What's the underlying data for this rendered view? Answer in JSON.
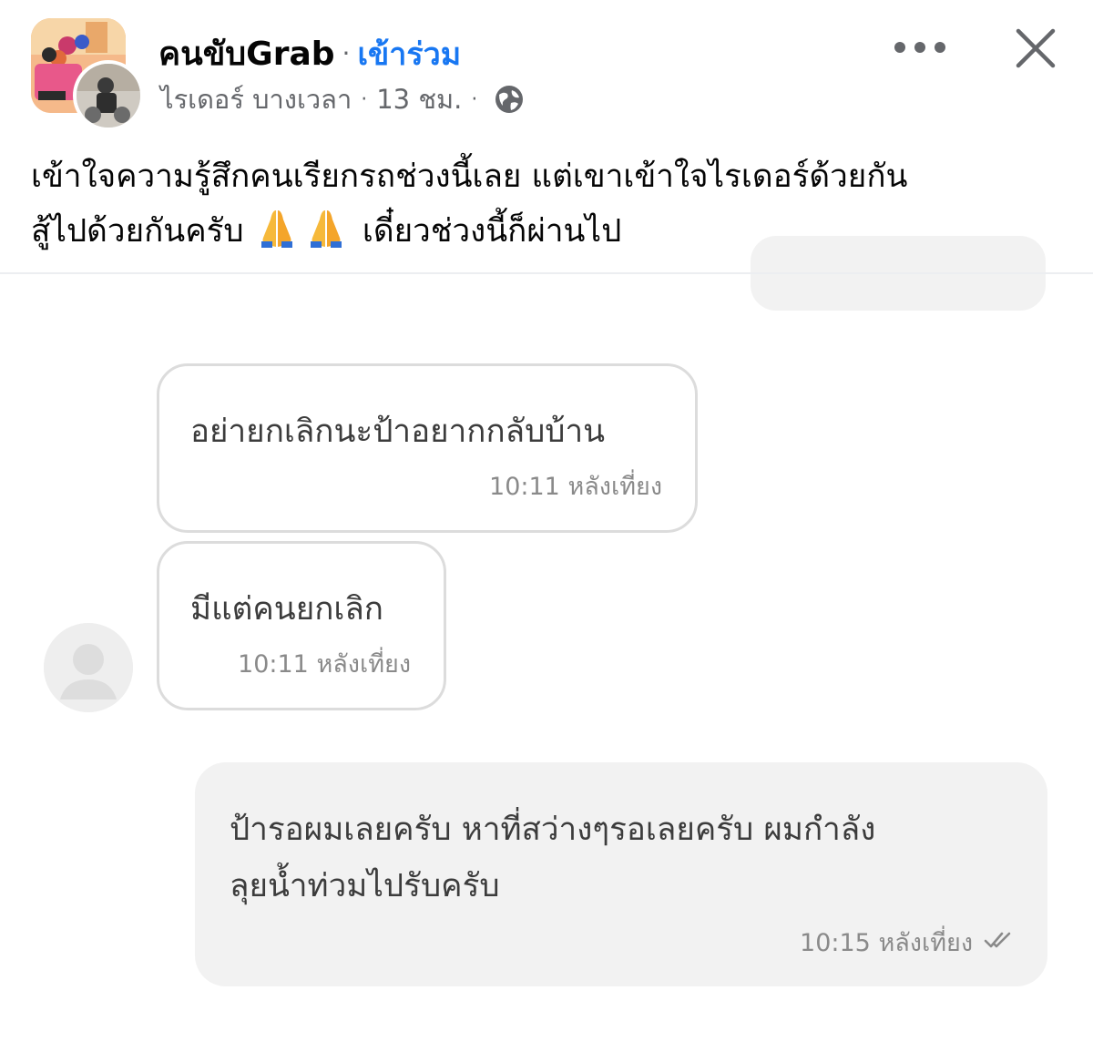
{
  "post": {
    "group_name": "คนขับGrab",
    "separator": "·",
    "join_label": "เข้าร่วม",
    "author": "ไรเดอร์ บางเวลา",
    "time_ago": "13 ชม.",
    "privacy_icon": "globe-icon",
    "text_line1": "เข้าใจความรู้สึกคนเรียกรถช่วงนี้เลย แต่เขาเข้าใจไรเดอร์ด้วยกัน",
    "text_line2_pre": "สู้ไปด้วยกันครับ",
    "text_line2_post": " เดี๋ยวช่วงนี้ก็ผ่านไป",
    "emoji": "folded-hands-icon"
  },
  "chat": {
    "messages": [
      {
        "direction": "incoming",
        "lines": [
          "อย่ายกเลิกนะป้าอยากกลับบ้าน"
        ],
        "time": "10:11 หลังเที่ยง"
      },
      {
        "direction": "incoming",
        "lines": [
          "มีแต่คนยกเลิก"
        ],
        "time": "10:11 หลังเที่ยง"
      },
      {
        "direction": "outgoing",
        "lines": [
          "ป้ารอผมเลยครับ หาที่สว่างๆรอเลยครับ ผมกำลัง",
          "ลุยน้ำท่วมไปรับครับ"
        ],
        "time": "10:15 หลังเที่ยง",
        "status_icon": "double-check-icon"
      }
    ]
  },
  "colors": {
    "accent_blue": "#1877f2",
    "secondary_text": "#65676b",
    "bubble_out_bg": "#f2f2f2",
    "bubble_in_border": "#dcdcdc"
  }
}
